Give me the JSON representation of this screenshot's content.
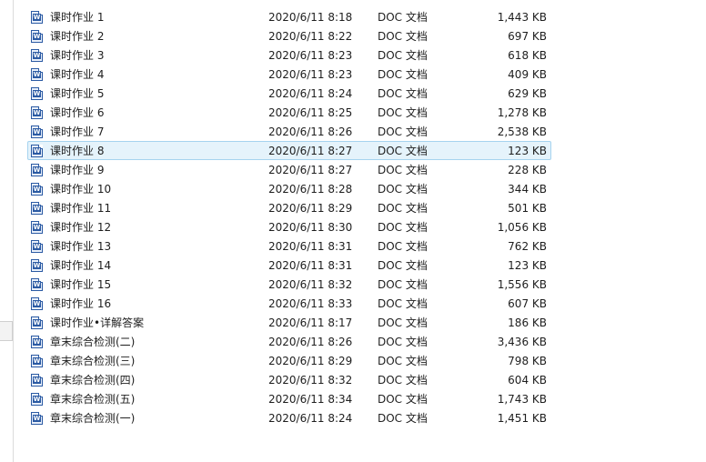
{
  "files": [
    {
      "name": "课时作业 1",
      "date": "2020/6/11 8:18",
      "type": "DOC 文档",
      "size": "1,443 KB"
    },
    {
      "name": "课时作业 2",
      "date": "2020/6/11 8:22",
      "type": "DOC 文档",
      "size": "697 KB"
    },
    {
      "name": "课时作业 3",
      "date": "2020/6/11 8:23",
      "type": "DOC 文档",
      "size": "618 KB"
    },
    {
      "name": "课时作业 4",
      "date": "2020/6/11 8:23",
      "type": "DOC 文档",
      "size": "409 KB"
    },
    {
      "name": "课时作业 5",
      "date": "2020/6/11 8:24",
      "type": "DOC 文档",
      "size": "629 KB"
    },
    {
      "name": "课时作业 6",
      "date": "2020/6/11 8:25",
      "type": "DOC 文档",
      "size": "1,278 KB"
    },
    {
      "name": "课时作业 7",
      "date": "2020/6/11 8:26",
      "type": "DOC 文档",
      "size": "2,538 KB"
    },
    {
      "name": "课时作业 8",
      "date": "2020/6/11 8:27",
      "type": "DOC 文档",
      "size": "123 KB"
    },
    {
      "name": "课时作业 9",
      "date": "2020/6/11 8:27",
      "type": "DOC 文档",
      "size": "228 KB"
    },
    {
      "name": "课时作业 10",
      "date": "2020/6/11 8:28",
      "type": "DOC 文档",
      "size": "344 KB"
    },
    {
      "name": "课时作业 11",
      "date": "2020/6/11 8:29",
      "type": "DOC 文档",
      "size": "501 KB"
    },
    {
      "name": "课时作业 12",
      "date": "2020/6/11 8:30",
      "type": "DOC 文档",
      "size": "1,056 KB"
    },
    {
      "name": "课时作业 13",
      "date": "2020/6/11 8:31",
      "type": "DOC 文档",
      "size": "762 KB"
    },
    {
      "name": "课时作业 14",
      "date": "2020/6/11 8:31",
      "type": "DOC 文档",
      "size": "123 KB"
    },
    {
      "name": "课时作业 15",
      "date": "2020/6/11 8:32",
      "type": "DOC 文档",
      "size": "1,556 KB"
    },
    {
      "name": "课时作业 16",
      "date": "2020/6/11 8:33",
      "type": "DOC 文档",
      "size": "607 KB"
    },
    {
      "name": "课时作业•详解答案",
      "date": "2020/6/11 8:17",
      "type": "DOC 文档",
      "size": "186 KB"
    },
    {
      "name": "章末综合检测(二)",
      "date": "2020/6/11 8:26",
      "type": "DOC 文档",
      "size": "3,436 KB"
    },
    {
      "name": "章末综合检测(三)",
      "date": "2020/6/11 8:29",
      "type": "DOC 文档",
      "size": "798 KB"
    },
    {
      "name": "章末综合检测(四)",
      "date": "2020/6/11 8:32",
      "type": "DOC 文档",
      "size": "604 KB"
    },
    {
      "name": "章末综合检测(五)",
      "date": "2020/6/11 8:34",
      "type": "DOC 文档",
      "size": "1,743 KB"
    },
    {
      "name": "章末综合检测(一)",
      "date": "2020/6/11 8:24",
      "type": "DOC 文档",
      "size": "1,451 KB"
    }
  ],
  "hovered_index": 7,
  "icon": {
    "name": "word-document-icon",
    "glyph": "W",
    "color": "#2b5aa3"
  }
}
